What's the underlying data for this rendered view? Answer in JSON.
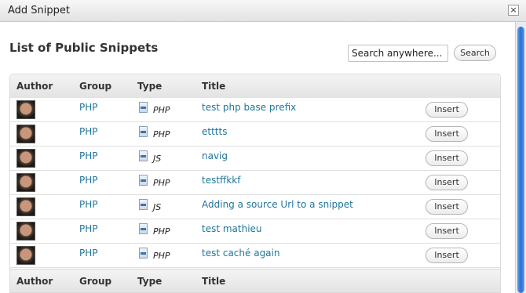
{
  "window": {
    "title": "Add Snippet",
    "close_label": "×"
  },
  "heading": "List of Public Snippets",
  "search": {
    "value": "Search anywhere...",
    "button_label": "Search"
  },
  "columns": [
    "Author",
    "Group",
    "Type",
    "Title"
  ],
  "rows": [
    {
      "group": "PHP",
      "type": "PHP",
      "title": "test php base prefix",
      "action": "Insert"
    },
    {
      "group": "PHP",
      "type": "PHP",
      "title": "etttts",
      "action": "Insert"
    },
    {
      "group": "PHP",
      "type": "JS",
      "title": "navig",
      "action": "Insert"
    },
    {
      "group": "PHP",
      "type": "PHP",
      "title": "testffkkf",
      "action": "Insert"
    },
    {
      "group": "PHP",
      "type": "JS",
      "title": "Adding a source Url to a snippet",
      "action": "Insert"
    },
    {
      "group": "PHP",
      "type": "PHP",
      "title": "test mathieu",
      "action": "Insert"
    },
    {
      "group": "PHP",
      "type": "PHP",
      "title": "test caché again",
      "action": "Insert"
    }
  ],
  "colors": {
    "link": "#21759b",
    "scroll_accent": "#2c6fd1"
  }
}
